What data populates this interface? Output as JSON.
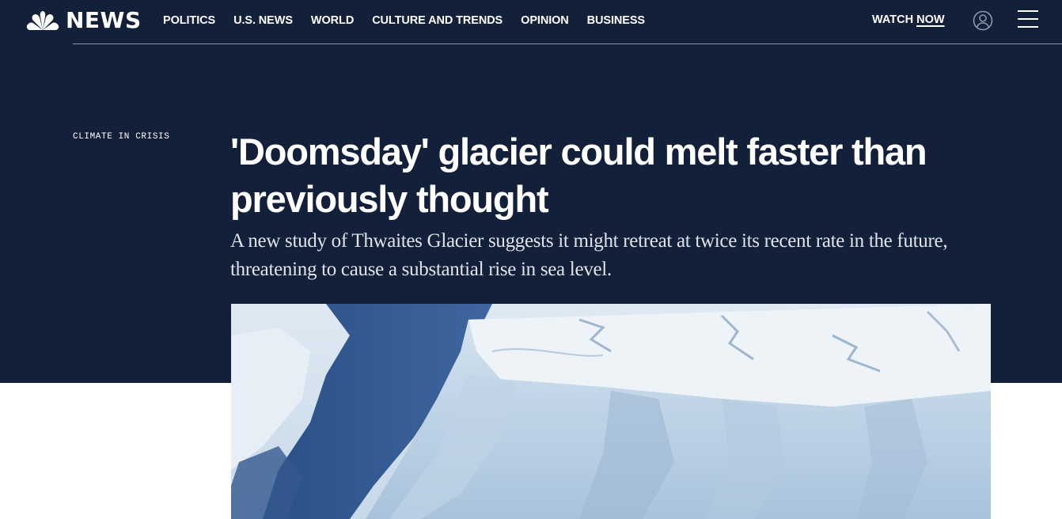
{
  "header": {
    "logo_text": "NEWS",
    "nav": [
      "POLITICS",
      "U.S. NEWS",
      "WORLD",
      "CULTURE AND TRENDS",
      "OPINION",
      "BUSINESS"
    ],
    "watch_label": "WATCH",
    "now_label": "NOW"
  },
  "article": {
    "eyebrow": "CLIMATE IN CRISIS",
    "headline": "'Doomsday' glacier could melt faster than previously thought",
    "dek": "A new study of Thwaites Glacier suggests it might retreat at twice its recent rate in the future, threatening to cause a substantial rise in sea level."
  },
  "colors": {
    "hero_background": "#132039",
    "text": "#ffffff"
  },
  "icons": {
    "logo": "peacock-icon",
    "account": "account-icon",
    "menu": "hamburger-menu-icon"
  }
}
